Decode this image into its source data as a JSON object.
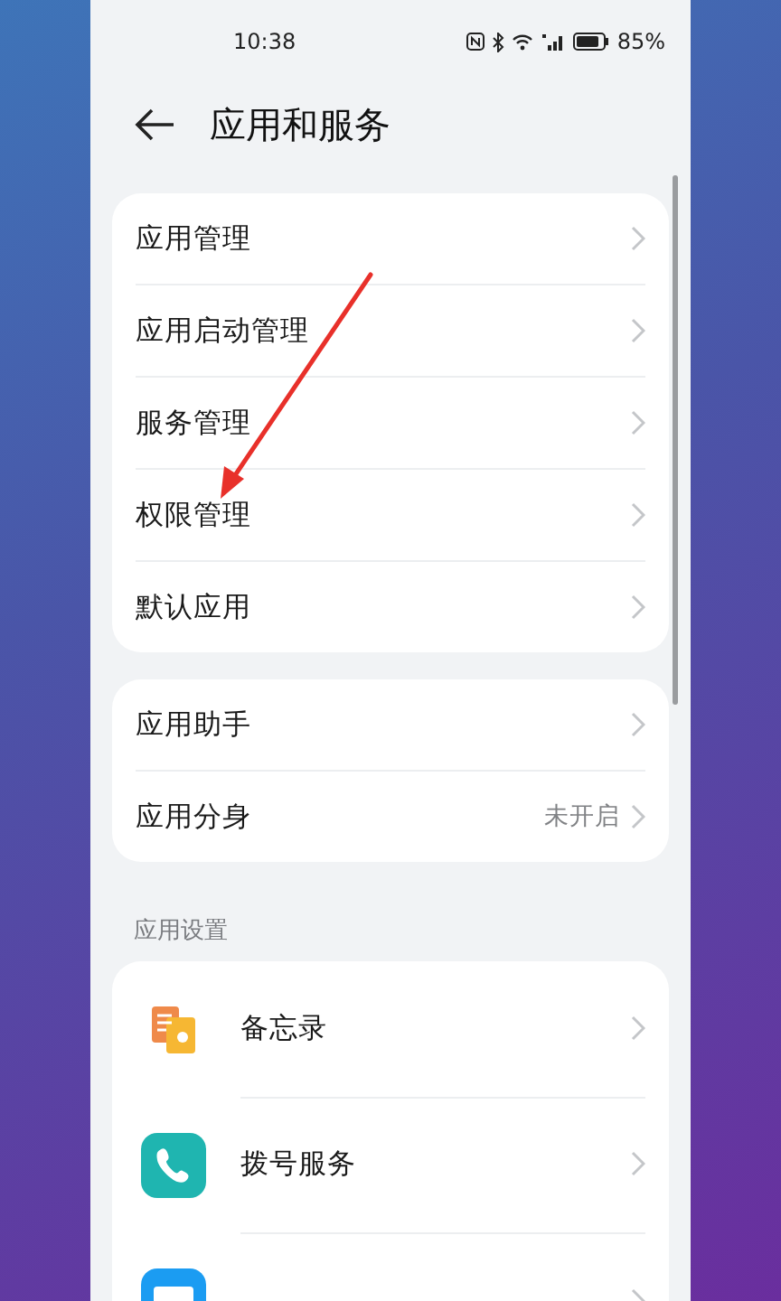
{
  "status_bar": {
    "time": "10:38",
    "battery": "85%"
  },
  "header": {
    "title": "应用和服务"
  },
  "groups": [
    {
      "items": [
        {
          "label": "应用管理"
        },
        {
          "label": "应用启动管理"
        },
        {
          "label": "服务管理"
        },
        {
          "label": "权限管理"
        },
        {
          "label": "默认应用"
        }
      ]
    },
    {
      "items": [
        {
          "label": "应用助手"
        },
        {
          "label": "应用分身",
          "value": "未开启"
        }
      ]
    }
  ],
  "section": {
    "title": "应用设置",
    "apps": [
      {
        "kind": "memo",
        "label": "备忘录"
      },
      {
        "kind": "phone",
        "label": "拨号服务"
      },
      {
        "kind": "mail"
      }
    ]
  }
}
